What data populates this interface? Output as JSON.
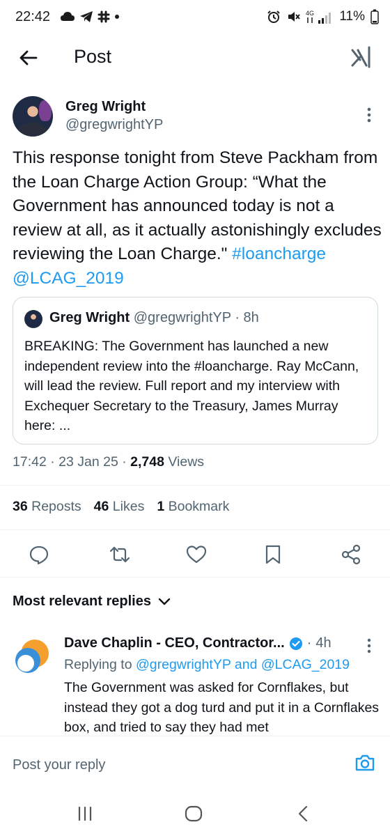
{
  "status_bar": {
    "time": "22:42",
    "battery": "11%",
    "left_icons": [
      "cloud-icon",
      "telegram-icon",
      "slack-icon",
      "dot-icon"
    ],
    "right_icons": [
      "alarm-icon",
      "mute-icon",
      "4g-signal-icon",
      "battery-icon"
    ]
  },
  "header": {
    "title": "Post",
    "back_icon": "arrow-left-icon",
    "grok_icon": "grok-icon"
  },
  "post": {
    "author_name": "Greg Wright",
    "author_handle": "@gregwrightYP",
    "text_main": "This response tonight from Steve Packham from the Loan Charge Action Group: “What the Government has announced today is not a review at all, as it actually astonishingly excludes reviewing the Loan Charge.\"",
    "hashtag": "#loancharge",
    "mention": "@LCAG_2019",
    "time": "17:42",
    "date": "23 Jan 25",
    "views_count": "2,748",
    "views_label": "Views"
  },
  "quote": {
    "name": "Greg Wright",
    "handle": "@gregwrightYP",
    "age": "8h",
    "text": "BREAKING: The Government has launched a new independent review into the #loancharge. Ray McCann, will lead the review.  Full report and my interview with Exchequer Secretary to the Treasury, James Murray here: ..."
  },
  "stats": {
    "reposts_count": "36",
    "reposts_label": "Reposts",
    "likes_count": "46",
    "likes_label": "Likes",
    "bookmarks_count": "1",
    "bookmarks_label": "Bookmark"
  },
  "actions": [
    "reply-icon",
    "repost-icon",
    "like-icon",
    "bookmark-icon",
    "share-icon"
  ],
  "replies": {
    "sort_label": "Most relevant replies",
    "items": [
      {
        "name": "Dave Chaplin - CEO, Contractor...",
        "age": "4h",
        "replying_prefix": "Replying to",
        "replying_to_1": "@gregwrightYP",
        "replying_and": "and",
        "replying_to_2": "@LCAG_2019",
        "text": "The Government was asked for Cornflakes, but instead they got a dog turd and put it in a Cornflakes box, and tried to say they had met"
      }
    ]
  },
  "composer": {
    "placeholder": "Post your reply"
  },
  "colors": {
    "accent": "#1d9bf0",
    "text": "#0f1419",
    "secondary": "#536471",
    "border": "#cfd9de"
  }
}
